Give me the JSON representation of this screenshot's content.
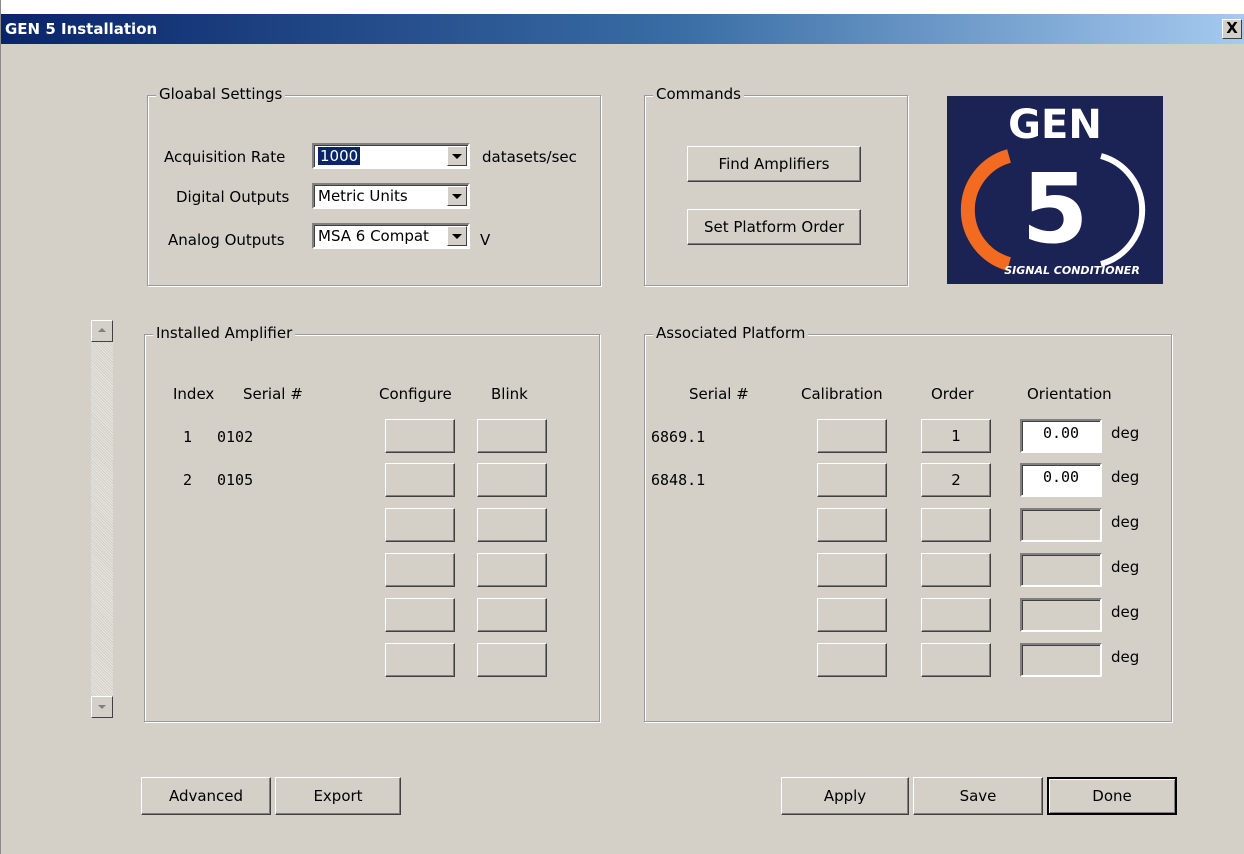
{
  "window": {
    "title": "GEN 5 Installation",
    "close_label": "X"
  },
  "global_settings": {
    "title": "Gloabal Settings",
    "acquisition_rate": {
      "label": "Acquisition Rate",
      "value": "1000",
      "unit": "datasets/sec"
    },
    "digital_outputs": {
      "label": "Digital Outputs",
      "value": "Metric Units"
    },
    "analog_outputs": {
      "label": "Analog Outputs",
      "value": "MSA 6 Compat",
      "unit": "V"
    }
  },
  "commands": {
    "title": "Commands",
    "find_amplifiers": "Find Amplifiers",
    "set_platform_order": "Set Platform Order"
  },
  "logo": {
    "brand": "GEN",
    "number": "5",
    "tagline": "SIGNAL CONDITIONER",
    "brand_color": "#1b2254",
    "accent_color": "#f26b21"
  },
  "installed_amplifier": {
    "title": "Installed Amplifier",
    "headers": {
      "index": "Index",
      "serial": "Serial #",
      "configure": "Configure",
      "blink": "Blink"
    },
    "rows": [
      {
        "index": "1",
        "serial": "0102"
      },
      {
        "index": "2",
        "serial": "0105"
      },
      {
        "index": "",
        "serial": ""
      },
      {
        "index": "",
        "serial": ""
      },
      {
        "index": "",
        "serial": ""
      },
      {
        "index": "",
        "serial": ""
      }
    ]
  },
  "associated_platform": {
    "title": "Associated Platform",
    "headers": {
      "serial": "Serial #",
      "calibration": "Calibration",
      "order": "Order",
      "orientation": "Orientation"
    },
    "unit": "deg",
    "rows": [
      {
        "serial": "6869.1",
        "order": "1",
        "orientation": "0.00"
      },
      {
        "serial": "6848.1",
        "order": "2",
        "orientation": "0.00"
      },
      {
        "serial": "",
        "order": "",
        "orientation": ""
      },
      {
        "serial": "",
        "order": "",
        "orientation": ""
      },
      {
        "serial": "",
        "order": "",
        "orientation": ""
      },
      {
        "serial": "",
        "order": "",
        "orientation": ""
      }
    ]
  },
  "footer": {
    "advanced": "Advanced",
    "export": "Export",
    "apply": "Apply",
    "save": "Save",
    "done": "Done"
  }
}
